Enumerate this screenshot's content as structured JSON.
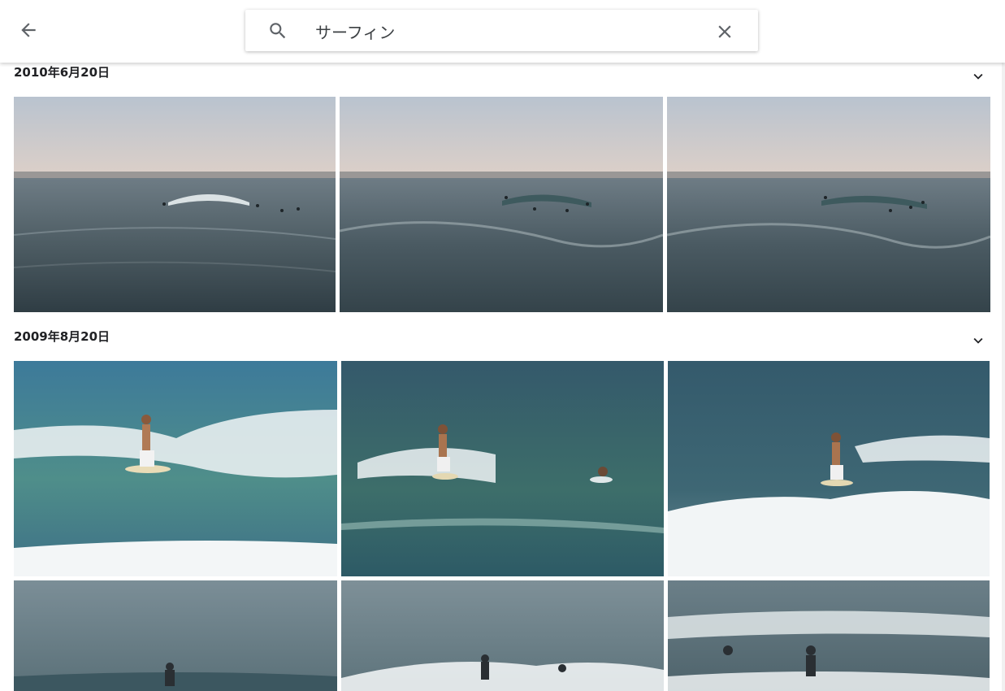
{
  "header": {
    "back_icon": "arrow-back-icon",
    "search_icon": "search-icon",
    "search_query": "サーフィン",
    "clear_icon": "close-icon"
  },
  "sections": [
    {
      "date": "2010年6月20日",
      "toggle_icon": "chevron-down-icon",
      "photos": [
        "surf-line-photo",
        "surf-line-photo",
        "surf-line-photo"
      ]
    },
    {
      "date": "2009年8月20日",
      "toggle_icon": "chevron-down-icon",
      "photos": [
        "surfer-photo",
        "surfer-photo",
        "surfer-photo",
        "surfer-photo",
        "surfer-photo",
        "surfer-photo"
      ]
    }
  ],
  "colors": {
    "sky": "#d8d4d3",
    "sea_evening": "#4a5a62",
    "sea_day": "#3f6e7f",
    "foam": "#f4f6f7"
  }
}
